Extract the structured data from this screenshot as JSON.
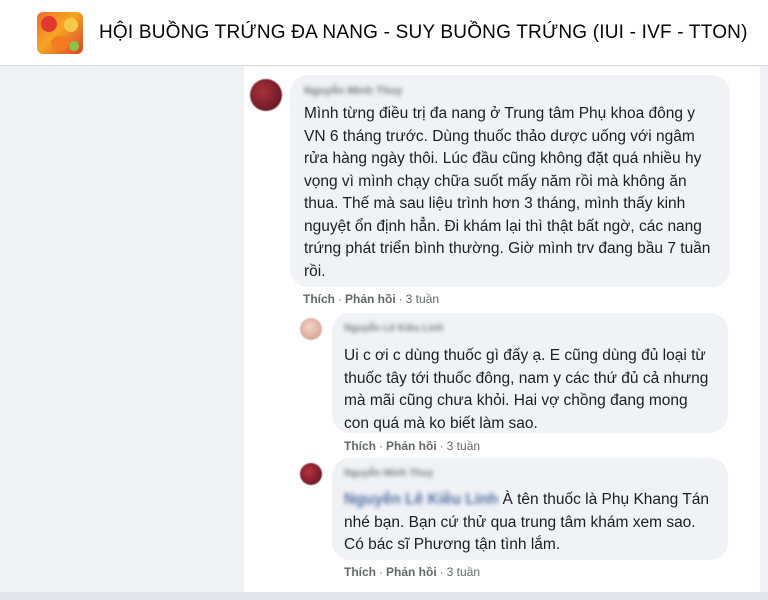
{
  "group": {
    "title": "HỘI BUỒNG TRỨNG ĐA NANG - SUY BUỒNG TRỨNG (IUI - IVF - TTON)"
  },
  "comments": [
    {
      "author": "Nguyễn Minh Thuy",
      "text": "Mình từng điều trị đa nang ở Trung tâm Phụ khoa đông y VN 6 tháng trước. Dùng thuốc thảo dược uống với ngâm rửa hàng ngày thôi. Lúc đầu cũng không đặt quá nhiều hy vọng vì mình chạy chữa suốt mấy năm rồi mà không ăn thua. Thế mà sau liệu trình hơn 3 tháng, mình thấy kinh nguyệt ổn định hẳn. Đi khám lại thì thật bất ngờ, các nang trứng phát triển bình thường. Giờ mình trv đang bầu 7 tuần rồi.",
      "like": "Thích",
      "reply": "Phản hồi",
      "time": "3 tuần"
    },
    {
      "author": "Nguyễn Lê Kiều Linh",
      "text": "Ui c ơi c dùng thuốc gì đấy ạ. E cũng dùng đủ loại từ thuốc tây tới thuốc đông, nam y các thứ đủ cả nhưng mà mãi cũng chưa khỏi. Hai vợ chồng đang mong con quá mà ko biết làm sao.",
      "like": "Thích",
      "reply": "Phản hồi",
      "time": "3 tuần"
    },
    {
      "author": "Nguyễn Minh Thuy",
      "mention": "Nguyễn Lê Kiều Linh",
      "text": " À tên thuốc là Phụ Khang Tán nhé bạn. Bạn cứ thử qua trung tâm khám xem sao. Có bác sĩ Phương tận tình lắm.",
      "like": "Thích",
      "reply": "Phản hồi",
      "time": "3 tuần"
    }
  ],
  "colors": {
    "bubble": "#f0f2f5",
    "text": "#1c1e21",
    "meta": "#65676b",
    "mention": "#385898"
  }
}
